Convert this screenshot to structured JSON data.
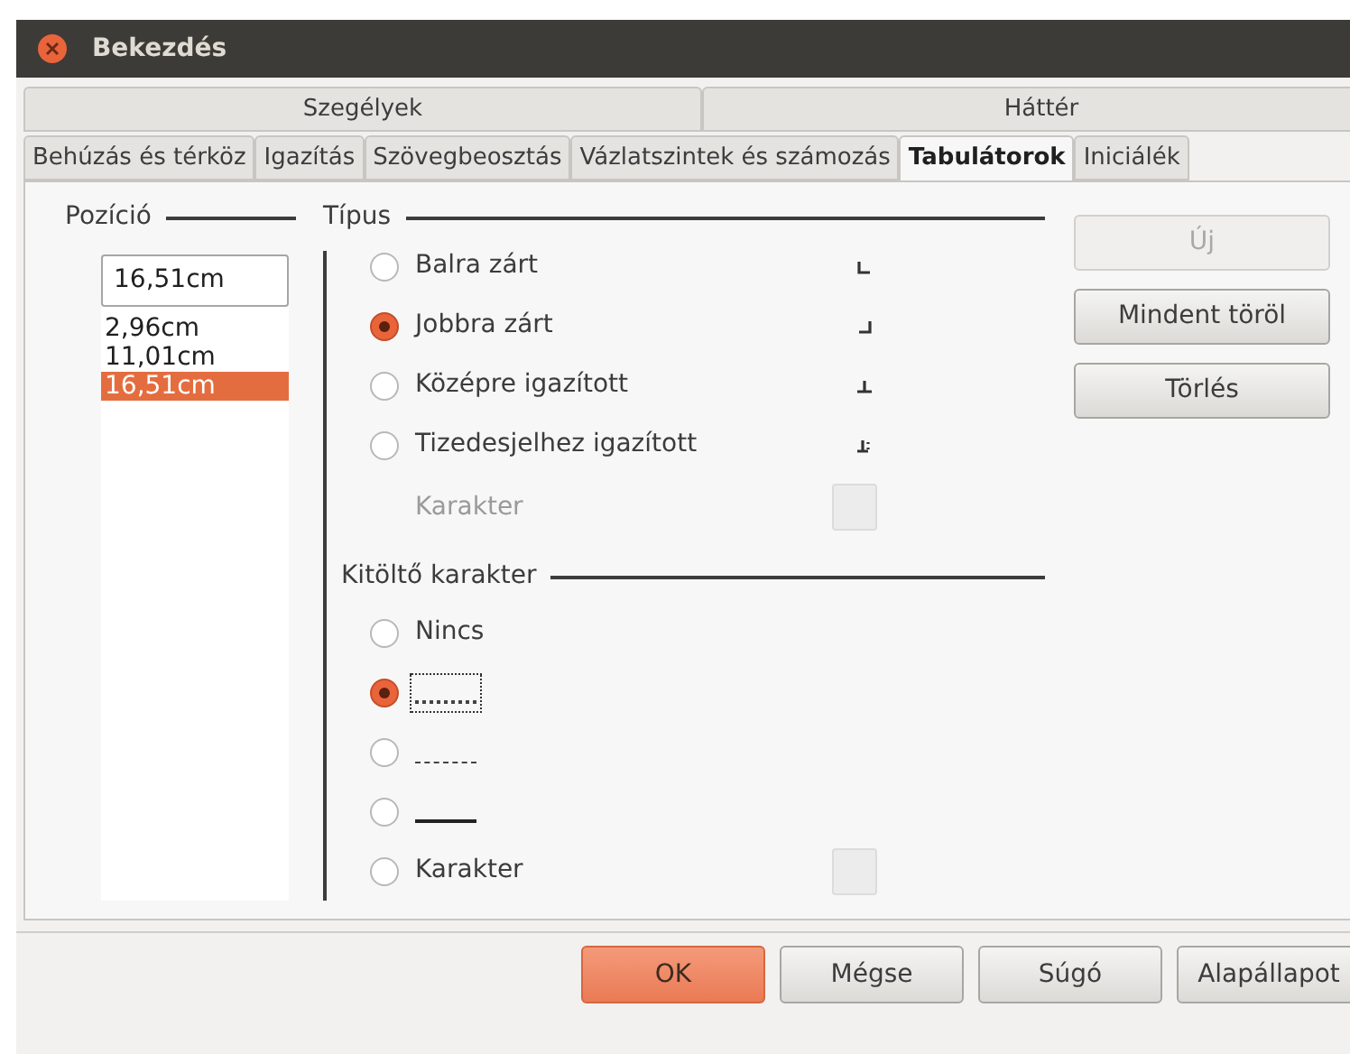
{
  "window": {
    "title": "Bekezdés"
  },
  "tab_rows": [
    [
      {
        "label": "Szegélyek",
        "selected": false
      },
      {
        "label": "Háttér",
        "selected": false
      }
    ],
    [
      {
        "label": "Behúzás és térköz",
        "selected": false
      },
      {
        "label": "Igazítás",
        "selected": false
      },
      {
        "label": "Szövegbeosztás",
        "selected": false
      },
      {
        "label": "Vázlatszintek és számozás",
        "selected": false
      },
      {
        "label": "Tabulátorok",
        "selected": true
      },
      {
        "label": "Iniciálék",
        "selected": false
      }
    ]
  ],
  "position": {
    "title": "Pozíció",
    "value": "16,51cm",
    "items": [
      {
        "label": "2,96cm",
        "selected": false
      },
      {
        "label": "11,01cm",
        "selected": false
      },
      {
        "label": "16,51cm",
        "selected": true
      }
    ]
  },
  "type": {
    "title": "Típus",
    "options": [
      {
        "label": "Balra zárt",
        "selected": false,
        "kind": "left"
      },
      {
        "label": "Jobbra zárt",
        "selected": true,
        "kind": "right"
      },
      {
        "label": "Középre igazított",
        "selected": false,
        "kind": "center"
      },
      {
        "label": "Tizedesjelhez igazított",
        "selected": false,
        "kind": "decimal"
      }
    ],
    "character": {
      "label": "Karakter",
      "disabled": true
    }
  },
  "fill": {
    "title": "Kitöltő karakter",
    "options": [
      {
        "kind": "text",
        "label": "Nincs",
        "selected": false
      },
      {
        "kind": "dots",
        "selected": true,
        "focused": true
      },
      {
        "kind": "dashes",
        "selected": false,
        "focused": false
      },
      {
        "kind": "underline",
        "selected": false,
        "focused": false
      },
      {
        "kind": "character",
        "label": "Karakter",
        "selected": false
      }
    ]
  },
  "side_buttons": [
    {
      "label": "Új",
      "disabled": true
    },
    {
      "label": "Mindent töröl",
      "disabled": false
    },
    {
      "label": "Törlés",
      "disabled": false
    }
  ],
  "footer_buttons": [
    {
      "label": "OK",
      "primary": true
    },
    {
      "label": "Mégse",
      "primary": false
    },
    {
      "label": "Súgó",
      "primary": false
    },
    {
      "label": "Alapállapot",
      "primary": false
    }
  ]
}
